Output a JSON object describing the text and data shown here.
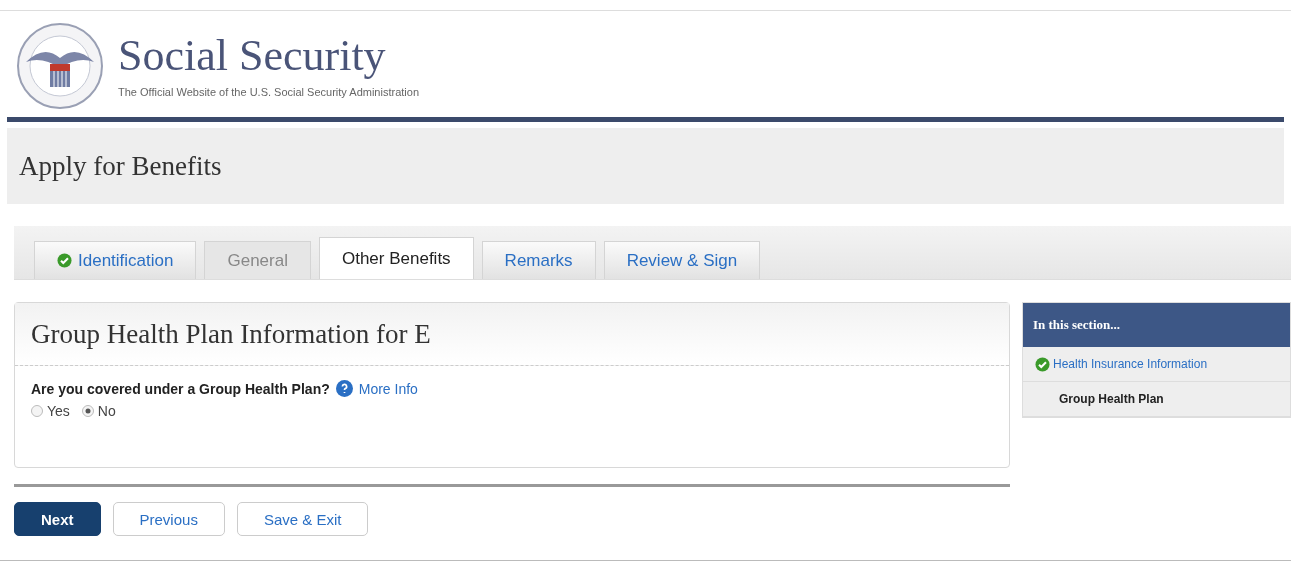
{
  "header": {
    "title": "Social Security",
    "tagline": "The Official Website of the U.S. Social Security Administration"
  },
  "page_title": "Apply for Benefits",
  "tabs": [
    {
      "label": "Identification",
      "selected": false,
      "done": true,
      "disabled": false
    },
    {
      "label": "General",
      "selected": false,
      "done": false,
      "disabled": true
    },
    {
      "label": "Other Benefits",
      "selected": true,
      "done": false,
      "disabled": false
    },
    {
      "label": "Remarks",
      "selected": false,
      "done": false,
      "disabled": false
    },
    {
      "label": "Review & Sign",
      "selected": false,
      "done": false,
      "disabled": false
    }
  ],
  "panel": {
    "title": "Group Health Plan Information for E",
    "question": "Are you covered under a Group Health Plan?",
    "more_info": "More Info",
    "options": [
      {
        "label": "Yes",
        "selected": false
      },
      {
        "label": "No",
        "selected": true
      }
    ]
  },
  "sidebar": {
    "title": "In this section...",
    "items": [
      {
        "label": "Health Insurance Information",
        "done": true,
        "selected": false
      },
      {
        "label": "Group Health Plan",
        "done": false,
        "selected": true
      }
    ]
  },
  "buttons": [
    {
      "label": "Next",
      "kind": "primary"
    },
    {
      "label": "Previous",
      "kind": "secondary"
    },
    {
      "label": "Save & Exit",
      "kind": "secondary"
    }
  ]
}
